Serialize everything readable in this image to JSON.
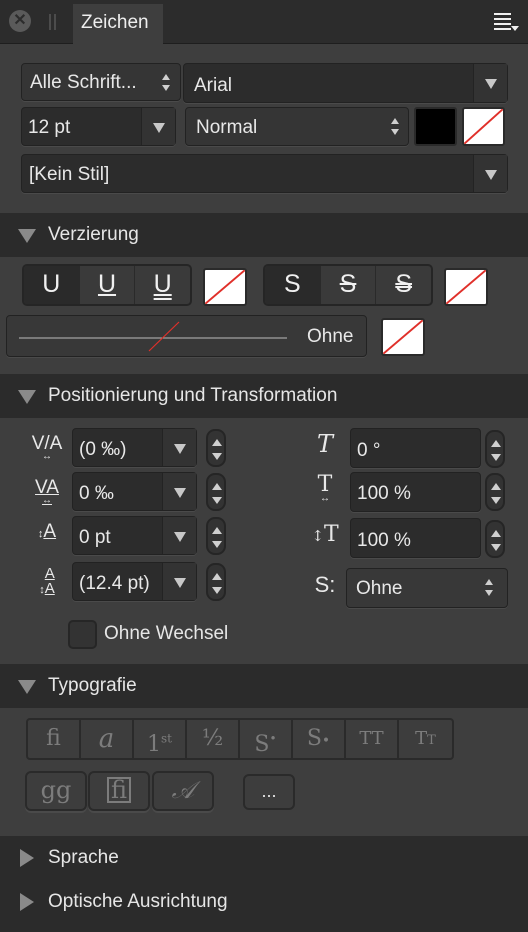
{
  "panel": {
    "tab_label": "Zeichen",
    "close_icon": "close-icon",
    "grip_icon": "grip-icon",
    "menu_icon": "panel-menu-icon"
  },
  "font": {
    "collection": "Alle Schrift...",
    "family": "Arial",
    "size": "12 pt",
    "style": "Normal",
    "text_color": "#000000",
    "background_color": "none",
    "paragraph_style": "[Kein Stil]"
  },
  "decoration": {
    "title": "Verzierung",
    "underline_buttons": [
      {
        "label": "U",
        "name": "no-underline",
        "selected": true
      },
      {
        "label": "U",
        "name": "single-underline",
        "selected": false
      },
      {
        "label": "U",
        "name": "double-underline",
        "selected": false
      }
    ],
    "strike_buttons": [
      {
        "label": "S",
        "name": "no-strikethrough",
        "selected": true
      },
      {
        "label": "S",
        "name": "single-strikethrough",
        "selected": false
      },
      {
        "label": "S",
        "name": "double-strikethrough",
        "selected": false
      }
    ],
    "outline_label": "Ohne"
  },
  "positioning": {
    "title": "Positionierung und Transformation",
    "left_fields": [
      {
        "name": "kerning",
        "value": "(0 ‰)"
      },
      {
        "name": "tracking",
        "value": "0 ‰"
      },
      {
        "name": "baseline-shift",
        "value": "0 pt"
      },
      {
        "name": "leading",
        "value": "(12.4 pt)"
      }
    ],
    "right_fields": [
      {
        "name": "shear",
        "value": "0 °",
        "icon": "T"
      },
      {
        "name": "horizontal-scale",
        "value": "100 %",
        "icon": "T"
      },
      {
        "name": "vertical-scale",
        "value": "100 %",
        "icon": "↕T"
      }
    ],
    "position_select": "Ohne",
    "position_icon": "S:",
    "no_break_label": "Ohne Wechsel",
    "no_break_checked": false
  },
  "typography": {
    "title": "Typografie",
    "row1": [
      {
        "name": "ligatures",
        "glyph": "ﬁ"
      },
      {
        "name": "alternates",
        "glyph": "a"
      },
      {
        "name": "ordinals",
        "glyph": "1st"
      },
      {
        "name": "fractions",
        "glyph": "½"
      },
      {
        "name": "superscript",
        "glyph": "S•"
      },
      {
        "name": "subscript",
        "glyph": "S."
      },
      {
        "name": "all-caps",
        "glyph": "TT"
      },
      {
        "name": "small-caps",
        "glyph": "Tт"
      }
    ],
    "row2": [
      {
        "name": "stylistic-alternates",
        "glyph": "gg"
      },
      {
        "name": "discretionary-ligatures",
        "glyph": "ﬁ"
      },
      {
        "name": "swash",
        "glyph": "𝒜"
      }
    ],
    "more_label": "..."
  },
  "collapsed_sections": [
    {
      "name": "language",
      "title": "Sprache"
    },
    {
      "name": "optical-alignment",
      "title": "Optische Ausrichtung"
    }
  ]
}
